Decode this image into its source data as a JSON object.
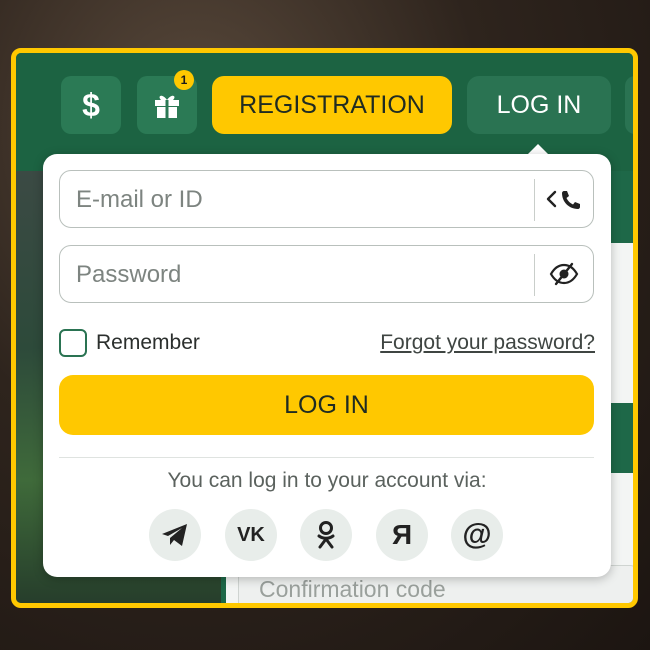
{
  "header": {
    "deposit_icon_glyph": "$",
    "gift_badge": "1",
    "registration_label": "REGISTRATION",
    "login_label": "LOG IN"
  },
  "background": {
    "confirmation_placeholder": "Confirmation code"
  },
  "login_popup": {
    "email_placeholder": "E-mail or ID",
    "password_placeholder": "Password",
    "remember_label": "Remember",
    "forgot_link": "Forgot your password?",
    "submit_label": "LOG IN",
    "via_text": "You can log in to your account via:",
    "social": [
      {
        "name": "telegram-icon"
      },
      {
        "name": "vk-icon",
        "glyph": "VK"
      },
      {
        "name": "odnoklassniki-icon"
      },
      {
        "name": "yandex-icon",
        "glyph": "Я"
      },
      {
        "name": "mailru-icon",
        "glyph": "@"
      }
    ]
  },
  "colors": {
    "accent_yellow": "#ffc800",
    "brand_green": "#1c6342",
    "button_green": "#2a7352"
  }
}
